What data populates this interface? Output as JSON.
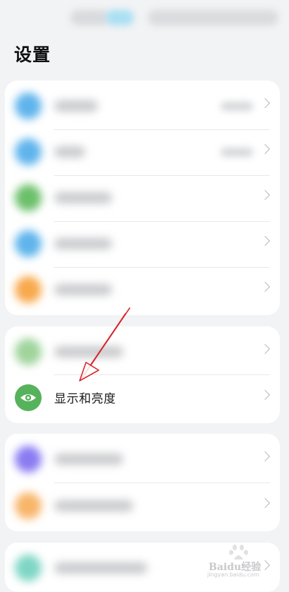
{
  "page": {
    "title": "设置"
  },
  "cards": [
    {
      "rows": [
        {
          "icon": "blurred-app-icon",
          "color": "#5fb4ec",
          "has_value": true
        },
        {
          "icon": "blurred-app-icon",
          "color": "#5fb4ec",
          "has_value": true
        },
        {
          "icon": "blurred-app-icon",
          "color": "#6bbf6a",
          "has_value": false
        },
        {
          "icon": "blurred-app-icon",
          "color": "#5fb4ec",
          "has_value": false
        },
        {
          "icon": "blurred-app-icon",
          "color": "#f8a94c",
          "has_value": false
        }
      ]
    },
    {
      "rows": [
        {
          "icon": "blurred-app-icon",
          "color": "#9fd49b",
          "has_value": false
        },
        {
          "icon": "eye-icon",
          "color": "#56b25b",
          "label": "显示和亮度"
        }
      ]
    },
    {
      "rows": [
        {
          "icon": "blurred-app-icon",
          "color": "#8a7bf2",
          "has_value": false
        },
        {
          "icon": "blurred-app-icon",
          "color": "#f8b56a",
          "has_value": false
        }
      ]
    },
    {
      "rows": [
        {
          "icon": "blurred-app-icon",
          "color": "#7fd6c5",
          "has_value": false
        }
      ]
    }
  ],
  "annotation": {
    "type": "red-arrow",
    "color": "#d7262c",
    "points_to": "显示和亮度"
  },
  "watermark": {
    "logo": "baidu-paw-logo",
    "text": "Baidu经验",
    "sub": "jingyan.baidu.com"
  },
  "colors": {
    "background": "#f2f3f5",
    "card": "#ffffff",
    "chevron": "#b9b9bd"
  }
}
